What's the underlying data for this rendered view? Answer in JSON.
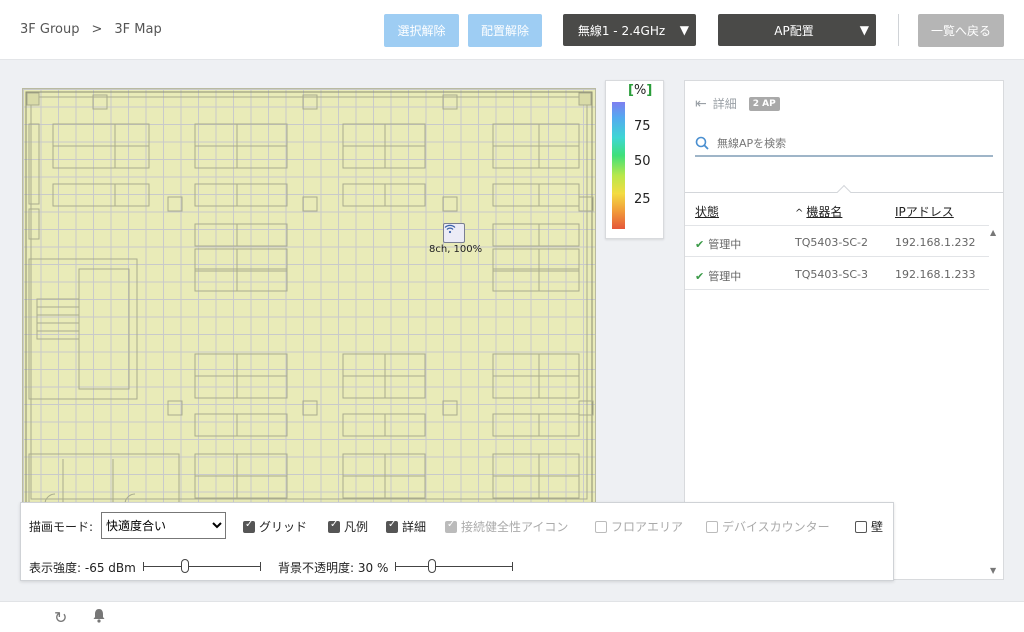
{
  "breadcrumb": {
    "group": "3F Group",
    "separator": ">",
    "map": "3F Map"
  },
  "toolbar": {
    "deselect_label": "選択解除",
    "unplace_label": "配置解除",
    "radio_label": "無線1 - 2.4GHz",
    "ap_place_label": "AP配置",
    "back_label": "一覧へ戻る"
  },
  "map": {
    "ap_label": "8ch, 100%",
    "ap_icon": "wifi-icon"
  },
  "legend": {
    "unit": "%",
    "ticks": [
      "75",
      "50",
      "25"
    ]
  },
  "panel": {
    "detail_label": "詳細",
    "ap_count": "2 AP",
    "search_placeholder": "無線APを検索",
    "columns": {
      "status": "状態",
      "sort_indicator": "^",
      "name": "機器名",
      "ip": "IPアドレス"
    },
    "rows": [
      {
        "status": "管理中",
        "name": "TQ5403-SC-2",
        "ip": "192.168.1.232"
      },
      {
        "status": "管理中",
        "name": "TQ5403-SC-3",
        "ip": "192.168.1.233"
      }
    ]
  },
  "controls": {
    "draw_mode_label": "描画モード:",
    "draw_mode_value": "快適度合い",
    "checkboxes": {
      "grid": {
        "label": "グリッド",
        "checked": true
      },
      "legend": {
        "label": "凡例",
        "checked": true
      },
      "detail": {
        "label": "詳細",
        "checked": true
      },
      "health_icon": {
        "label": "接続健全性アイコン",
        "checked": true,
        "disabled": true
      },
      "floor_area": {
        "label": "フロアエリア",
        "checked": false,
        "disabled": true
      },
      "device_counter": {
        "label": "デバイスカウンター",
        "checked": false,
        "disabled": true
      },
      "wall": {
        "label": "壁",
        "checked": false
      }
    },
    "strength_label": "表示強度: -65 dBm",
    "opacity_label": "背景不透明度: 30 %"
  },
  "colors": {
    "accent_light": "#9ecdf3",
    "dark_button": "#4a4a48",
    "ok_green": "#3a9a47"
  }
}
